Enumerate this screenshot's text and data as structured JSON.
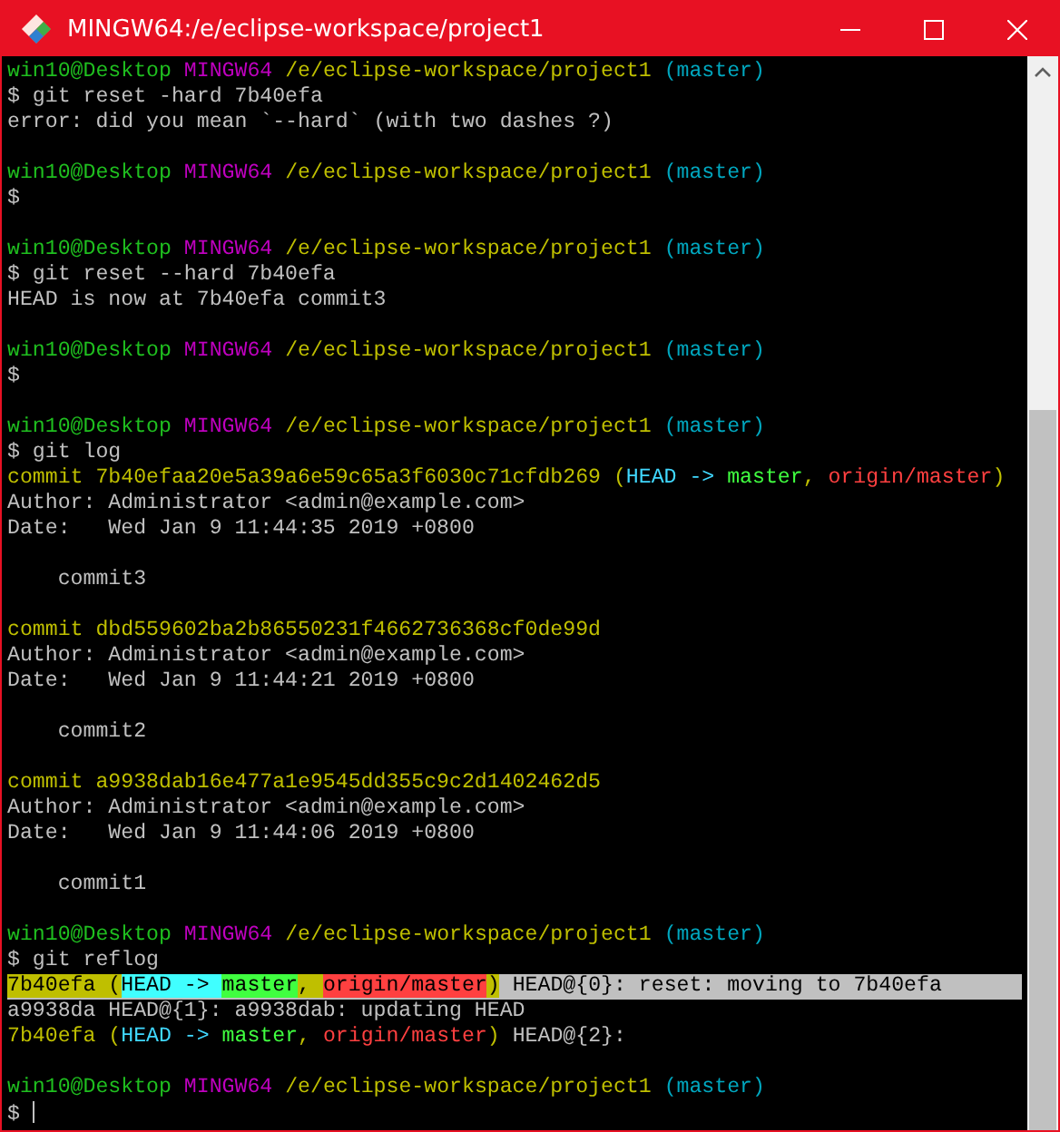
{
  "window": {
    "title": "MINGW64:/e/eclipse-workspace/project1"
  },
  "terminal": {
    "cursor": true,
    "lines": [
      {
        "kind": "text",
        "selected": false,
        "segments": [
          {
            "text": "win10@Desktop ",
            "color": "#1fbf1f"
          },
          {
            "text": "MINGW64 ",
            "color": "#bf00bf"
          },
          {
            "text": "/e/eclipse-workspace/project1 ",
            "color": "#bfbf00"
          },
          {
            "text": "(master)",
            "color": "#00a7bf"
          }
        ]
      },
      {
        "kind": "text",
        "selected": false,
        "segments": [
          {
            "text": "$ git reset -hard 7b40efa",
            "color": "#c0c0c0"
          }
        ]
      },
      {
        "kind": "text",
        "selected": false,
        "segments": [
          {
            "text": "error: did you mean `--hard` (with two dashes ?)",
            "color": "#c0c0c0"
          }
        ]
      },
      {
        "kind": "blank"
      },
      {
        "kind": "text",
        "selected": false,
        "segments": [
          {
            "text": "win10@Desktop ",
            "color": "#1fbf1f"
          },
          {
            "text": "MINGW64 ",
            "color": "#bf00bf"
          },
          {
            "text": "/e/eclipse-workspace/project1 ",
            "color": "#bfbf00"
          },
          {
            "text": "(master)",
            "color": "#00a7bf"
          }
        ]
      },
      {
        "kind": "text",
        "selected": false,
        "segments": [
          {
            "text": "$",
            "color": "#c0c0c0"
          }
        ]
      },
      {
        "kind": "blank"
      },
      {
        "kind": "text",
        "selected": false,
        "segments": [
          {
            "text": "win10@Desktop ",
            "color": "#1fbf1f"
          },
          {
            "text": "MINGW64 ",
            "color": "#bf00bf"
          },
          {
            "text": "/e/eclipse-workspace/project1 ",
            "color": "#bfbf00"
          },
          {
            "text": "(master)",
            "color": "#00a7bf"
          }
        ]
      },
      {
        "kind": "text",
        "selected": false,
        "segments": [
          {
            "text": "$ git reset --hard 7b40efa",
            "color": "#c0c0c0"
          }
        ]
      },
      {
        "kind": "text",
        "selected": false,
        "segments": [
          {
            "text": "HEAD is now at 7b40efa commit3",
            "color": "#c0c0c0"
          }
        ]
      },
      {
        "kind": "blank"
      },
      {
        "kind": "text",
        "selected": false,
        "segments": [
          {
            "text": "win10@Desktop ",
            "color": "#1fbf1f"
          },
          {
            "text": "MINGW64 ",
            "color": "#bf00bf"
          },
          {
            "text": "/e/eclipse-workspace/project1 ",
            "color": "#bfbf00"
          },
          {
            "text": "(master)",
            "color": "#00a7bf"
          }
        ]
      },
      {
        "kind": "text",
        "selected": false,
        "segments": [
          {
            "text": "$",
            "color": "#c0c0c0"
          }
        ]
      },
      {
        "kind": "blank"
      },
      {
        "kind": "text",
        "selected": false,
        "segments": [
          {
            "text": "win10@Desktop ",
            "color": "#1fbf1f"
          },
          {
            "text": "MINGW64 ",
            "color": "#bf00bf"
          },
          {
            "text": "/e/eclipse-workspace/project1 ",
            "color": "#bfbf00"
          },
          {
            "text": "(master)",
            "color": "#00a7bf"
          }
        ]
      },
      {
        "kind": "text",
        "selected": false,
        "segments": [
          {
            "text": "$ git log",
            "color": "#c0c0c0"
          }
        ]
      },
      {
        "kind": "text",
        "selected": false,
        "segments": [
          {
            "text": "commit 7b40efaa20e5a39a6e59c65a3f6030c71cfdb269 (",
            "color": "#bfbf00"
          },
          {
            "text": "HEAD -> ",
            "color": "#40d8ff"
          },
          {
            "text": "master",
            "color": "#40ff40"
          },
          {
            "text": ", ",
            "color": "#bfbf00"
          },
          {
            "text": "origin/master",
            "color": "#ff4040"
          },
          {
            "text": ")",
            "color": "#bfbf00"
          }
        ]
      },
      {
        "kind": "text",
        "selected": false,
        "segments": [
          {
            "text": "Author: Administrator <admin@example.com>",
            "color": "#c0c0c0"
          }
        ]
      },
      {
        "kind": "text",
        "selected": false,
        "segments": [
          {
            "text": "Date:   Wed Jan 9 11:44:35 2019 +0800",
            "color": "#c0c0c0"
          }
        ]
      },
      {
        "kind": "blank"
      },
      {
        "kind": "text",
        "selected": false,
        "segments": [
          {
            "text": "    commit3",
            "color": "#c0c0c0"
          }
        ]
      },
      {
        "kind": "blank"
      },
      {
        "kind": "text",
        "selected": false,
        "segments": [
          {
            "text": "commit dbd559602ba2b86550231f4662736368cf0de99d",
            "color": "#bfbf00"
          }
        ]
      },
      {
        "kind": "text",
        "selected": false,
        "segments": [
          {
            "text": "Author: Administrator <admin@example.com>",
            "color": "#c0c0c0"
          }
        ]
      },
      {
        "kind": "text",
        "selected": false,
        "segments": [
          {
            "text": "Date:   Wed Jan 9 11:44:21 2019 +0800",
            "color": "#c0c0c0"
          }
        ]
      },
      {
        "kind": "blank"
      },
      {
        "kind": "text",
        "selected": false,
        "segments": [
          {
            "text": "    commit2",
            "color": "#c0c0c0"
          }
        ]
      },
      {
        "kind": "blank"
      },
      {
        "kind": "text",
        "selected": false,
        "segments": [
          {
            "text": "commit a9938dab16e477a1e9545dd355c9c2d1402462d5",
            "color": "#bfbf00"
          }
        ]
      },
      {
        "kind": "text",
        "selected": false,
        "segments": [
          {
            "text": "Author: Administrator <admin@example.com>",
            "color": "#c0c0c0"
          }
        ]
      },
      {
        "kind": "text",
        "selected": false,
        "segments": [
          {
            "text": "Date:   Wed Jan 9 11:44:06 2019 +0800",
            "color": "#c0c0c0"
          }
        ]
      },
      {
        "kind": "blank"
      },
      {
        "kind": "text",
        "selected": false,
        "segments": [
          {
            "text": "    commit1",
            "color": "#c0c0c0"
          }
        ]
      },
      {
        "kind": "blank"
      },
      {
        "kind": "text",
        "selected": false,
        "segments": [
          {
            "text": "win10@Desktop ",
            "color": "#1fbf1f"
          },
          {
            "text": "MINGW64 ",
            "color": "#bf00bf"
          },
          {
            "text": "/e/eclipse-workspace/project1 ",
            "color": "#bfbf00"
          },
          {
            "text": "(master)",
            "color": "#00a7bf"
          }
        ]
      },
      {
        "kind": "text",
        "selected": false,
        "segments": [
          {
            "text": "$ git reflog",
            "color": "#c0c0c0"
          }
        ]
      },
      {
        "kind": "text",
        "selected": true,
        "segments": [
          {
            "text": "7b40efa (",
            "color": "#bfbf00"
          },
          {
            "text": "HEAD -> ",
            "color": "#40ffff"
          },
          {
            "text": "master",
            "color": "#40ff40"
          },
          {
            "text": ", ",
            "color": "#bfbf00"
          },
          {
            "text": "origin/master",
            "color": "#ff4040"
          },
          {
            "text": ")",
            "color": "#bfbf00"
          },
          {
            "text": " HEAD@{0}: reset: moving to 7b40efa",
            "color": "#c0c0c0"
          }
        ]
      },
      {
        "kind": "text",
        "selected": false,
        "segments": [
          {
            "text": "a9938da HEAD@{1}: a9938dab: updating HEAD",
            "color": "#c0c0c0"
          }
        ]
      },
      {
        "kind": "text",
        "selected": false,
        "segments": [
          {
            "text": "7b40efa (",
            "color": "#bfbf00"
          },
          {
            "text": "HEAD -> ",
            "color": "#40d8ff"
          },
          {
            "text": "master",
            "color": "#40ff40"
          },
          {
            "text": ", ",
            "color": "#bfbf00"
          },
          {
            "text": "origin/master",
            "color": "#ff4040"
          },
          {
            "text": ")",
            "color": "#bfbf00"
          },
          {
            "text": " HEAD@{2}:",
            "color": "#c0c0c0"
          }
        ]
      },
      {
        "kind": "blank"
      },
      {
        "kind": "text",
        "selected": false,
        "segments": [
          {
            "text": "win10@Desktop ",
            "color": "#1fbf1f"
          },
          {
            "text": "MINGW64 ",
            "color": "#bf00bf"
          },
          {
            "text": "/e/eclipse-workspace/project1 ",
            "color": "#bfbf00"
          },
          {
            "text": "(master)",
            "color": "#00a7bf"
          }
        ]
      },
      {
        "kind": "text",
        "selected": false,
        "segments": [
          {
            "text": "$ ",
            "color": "#c0c0c0"
          }
        ]
      }
    ]
  }
}
